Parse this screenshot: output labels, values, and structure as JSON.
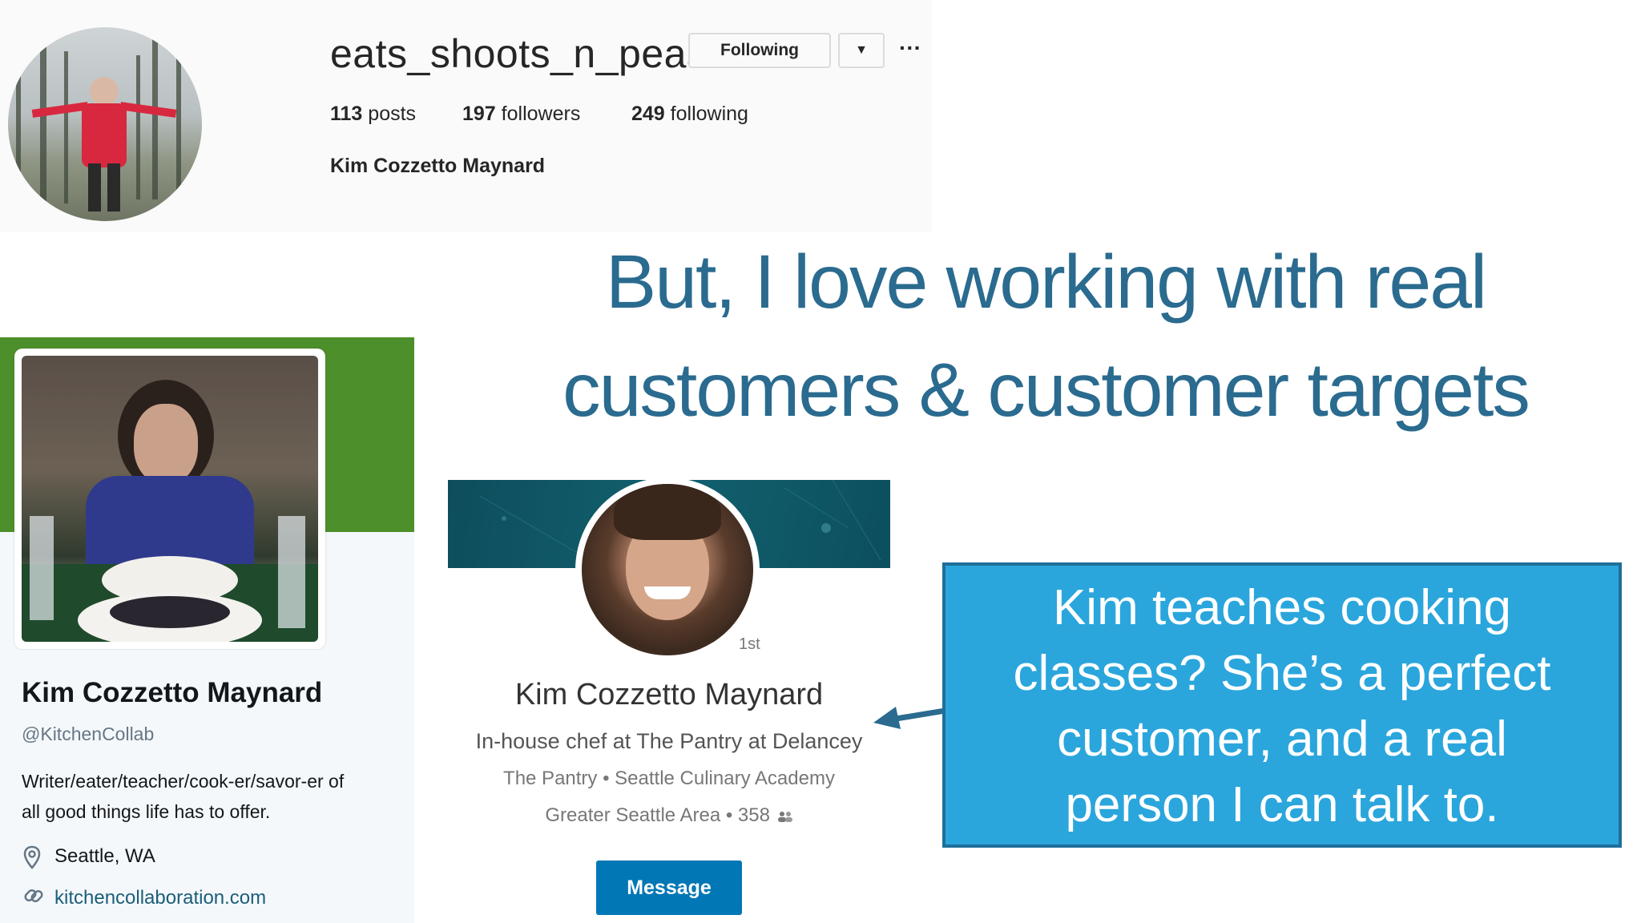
{
  "instagram": {
    "username": "eats_shoots_n_peas",
    "following_button": "Following",
    "dropdown_glyph": "▼",
    "more_glyph": "···",
    "stats": {
      "posts_count": "113",
      "posts_label": "posts",
      "followers_count": "197",
      "followers_label": "followers",
      "following_count": "249",
      "following_label": "following"
    },
    "full_name": "Kim Cozzetto Maynard"
  },
  "headline": {
    "line1": "But, I love working with real",
    "line2": "customers & customer targets"
  },
  "twitter": {
    "name": "Kim Cozzetto Maynard",
    "handle": "@KitchenCollab",
    "bio_line1": "Writer/eater/teacher/cook-er/savor-er of",
    "bio_line2": "all good things life has to offer.",
    "location": "Seattle, WA",
    "url": "kitchencollaboration.com",
    "banner_color": "#4d8f2a"
  },
  "linkedin": {
    "degree": "1st",
    "name": "Kim Cozzetto Maynard",
    "headline": "In-house chef at The Pantry at Delancey",
    "company": "The Pantry • Seattle Culinary Academy",
    "location": "Greater Seattle Area • 358",
    "connections_icon": "people-icon",
    "message_button": "Message",
    "accent": "#0277b5"
  },
  "callout": {
    "line1": "Kim teaches cooking",
    "line2": "classes? She’s a perfect",
    "line3": "customer, and a real",
    "line4": "person I can talk to.",
    "fill": "#2aa6dc"
  },
  "colors": {
    "headline": "#2a6b8f",
    "arrow": "#2a6b8f"
  }
}
